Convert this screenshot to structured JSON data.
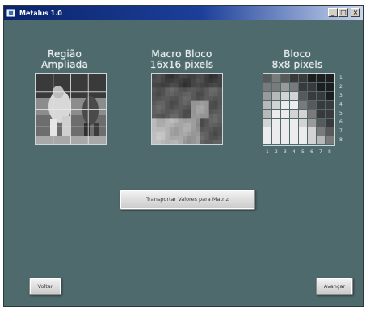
{
  "window": {
    "title": "Metalus 1.0",
    "controls": [
      "_",
      "□",
      "×"
    ]
  },
  "labels": {
    "regiao_line1": "Região",
    "regiao_line2": "Ampliada",
    "macro_line1": "Macro Bloco",
    "macro_line2": "16x16 pixels",
    "bloco_line1": "Bloco",
    "bloco_line2": "8x8 pixels"
  },
  "bloco_row_numbers": [
    "1",
    "2",
    "3",
    "4",
    "5",
    "6",
    "7",
    "8"
  ],
  "bloco_col_numbers": [
    "1",
    "2",
    "3",
    "4",
    "5",
    "6",
    "7",
    "8"
  ],
  "bloco_grid": [
    [
      2,
      3,
      2,
      1,
      1,
      0,
      0,
      0
    ],
    [
      3,
      3,
      4,
      3,
      1,
      1,
      0,
      0
    ],
    [
      4,
      5,
      6,
      6,
      2,
      1,
      1,
      0
    ],
    [
      5,
      6,
      7,
      7,
      3,
      2,
      1,
      1
    ],
    [
      5,
      7,
      7,
      6,
      6,
      3,
      1,
      1
    ],
    [
      6,
      7,
      7,
      7,
      6,
      4,
      2,
      1
    ],
    [
      7,
      7,
      7,
      7,
      7,
      6,
      3,
      2
    ],
    [
      7,
      7,
      7,
      7,
      7,
      6,
      5,
      3
    ]
  ],
  "buttons": {
    "transport": "Transportar Valores para Matriz",
    "back": "Voltar",
    "forward": "Avançar"
  }
}
